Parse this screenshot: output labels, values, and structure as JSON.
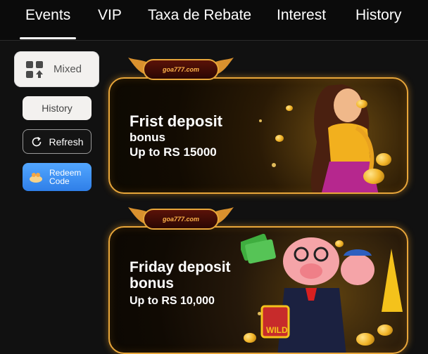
{
  "tabs": [
    {
      "label": "Events",
      "active": true
    },
    {
      "label": "VIP",
      "active": false
    },
    {
      "label": "Taxa de Rebate",
      "active": false
    },
    {
      "label": "Interest",
      "active": false
    },
    {
      "label": "History",
      "active": false
    }
  ],
  "sidebar": {
    "mixed": {
      "label": "Mixed",
      "icon": "grid-shapes-icon"
    },
    "history": {
      "label": "History"
    },
    "refresh": {
      "label": "Refresh",
      "icon": "refresh-icon"
    },
    "redeem": {
      "line1": "Redeem",
      "line2": "Code",
      "icon": "gift-icon"
    }
  },
  "banners": [
    {
      "logo": "goa777.com",
      "title": "Frist deposit",
      "subtitle": "bonus",
      "detail": "Up to RS 15000",
      "art": "woman-in-sari-with-gold-coins"
    },
    {
      "logo": "goa777.com",
      "title": "Friday deposit",
      "subtitle": "bonus",
      "detail_prefix": "Up to RS ",
      "detail_value": "10,000",
      "art": "pig-characters-with-cash-and-wild-symbol"
    }
  ],
  "colors": {
    "accent_gold": "#e8a63a",
    "redeem_blue": "#3a8cf2",
    "background": "#111111"
  }
}
